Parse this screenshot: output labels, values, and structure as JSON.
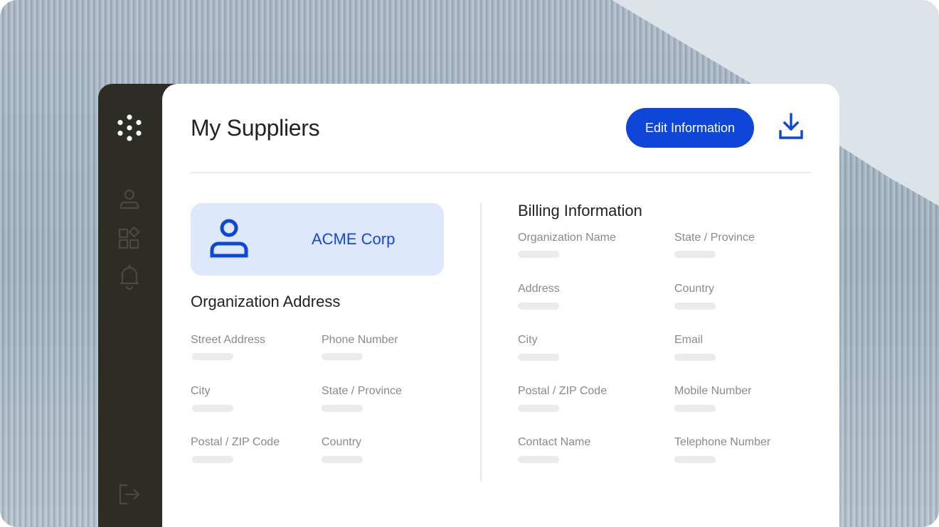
{
  "app": {
    "title": "My Suppliers",
    "edit_button_label": "Edit Information",
    "accent_color": "#0e46d8"
  },
  "sidebar": {
    "logo": "dots-flower-logo",
    "items": [
      {
        "icon": "user-icon"
      },
      {
        "icon": "apps-icon"
      },
      {
        "icon": "bell-icon"
      }
    ],
    "footer": {
      "icon": "logout-icon"
    }
  },
  "company": {
    "name": "ACME Corp",
    "icon": "user-icon"
  },
  "org_address": {
    "title": "Organization Address",
    "fields": [
      {
        "label": "Street Address",
        "value": ""
      },
      {
        "label": "Phone Number",
        "value": ""
      },
      {
        "label": "City",
        "value": ""
      },
      {
        "label": "State / Province",
        "value": ""
      },
      {
        "label": "Postal / ZIP Code",
        "value": ""
      },
      {
        "label": "Country",
        "value": ""
      }
    ]
  },
  "billing": {
    "title": "Billing Information",
    "fields": [
      {
        "label": "Organization Name",
        "value": ""
      },
      {
        "label": "State / Province",
        "value": ""
      },
      {
        "label": "Address",
        "value": ""
      },
      {
        "label": "Country",
        "value": ""
      },
      {
        "label": "City",
        "value": ""
      },
      {
        "label": "Email",
        "value": ""
      },
      {
        "label": "Postal / ZIP Code",
        "value": ""
      },
      {
        "label": "Mobile Number",
        "value": ""
      },
      {
        "label": "Contact Name",
        "value": ""
      },
      {
        "label": "Telephone Number",
        "value": ""
      }
    ]
  }
}
